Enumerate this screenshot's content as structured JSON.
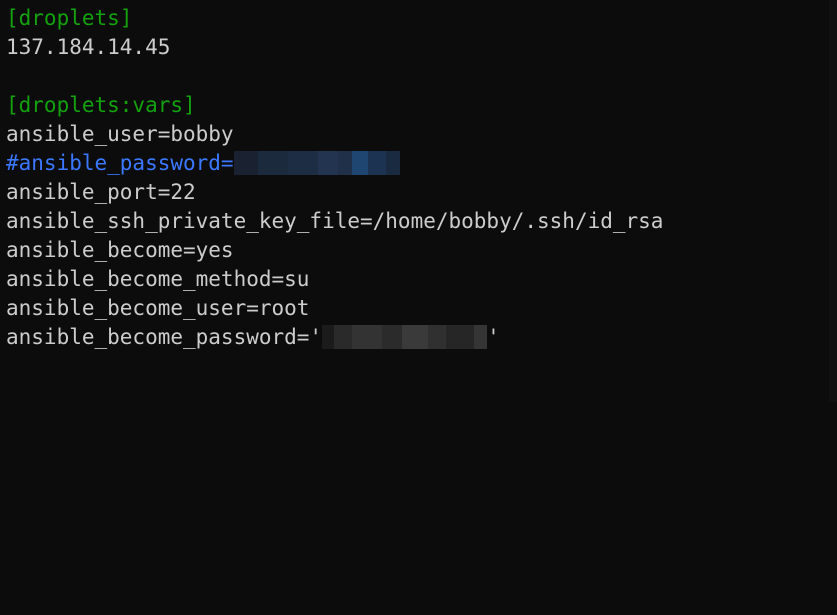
{
  "lines": [
    {
      "type": "section",
      "text": "[droplets]"
    },
    {
      "type": "normal",
      "text": "137.184.14.45"
    },
    {
      "type": "blank",
      "text": ""
    },
    {
      "type": "section",
      "text": "[droplets:vars]"
    },
    {
      "type": "normal",
      "text": "ansible_user=bobby"
    },
    {
      "type": "comment",
      "text": "#ansible_password="
    },
    {
      "type": "normal",
      "text": "ansible_port=22"
    },
    {
      "type": "normal",
      "text": "ansible_ssh_private_key_file=/home/bobby/.ssh/id_rsa"
    },
    {
      "type": "normal",
      "text": "ansible_become=yes"
    },
    {
      "type": "normal",
      "text": "ansible_become_method=su"
    },
    {
      "type": "normal",
      "text": "ansible_become_user=root"
    },
    {
      "type": "normal",
      "text": "ansible_become_password='"
    },
    {
      "type": "normal",
      "text": "'"
    }
  ],
  "colors": {
    "background": "#0c0c0c",
    "section": "#13a10e",
    "comment": "#3b78ff",
    "text": "#cccccc"
  }
}
